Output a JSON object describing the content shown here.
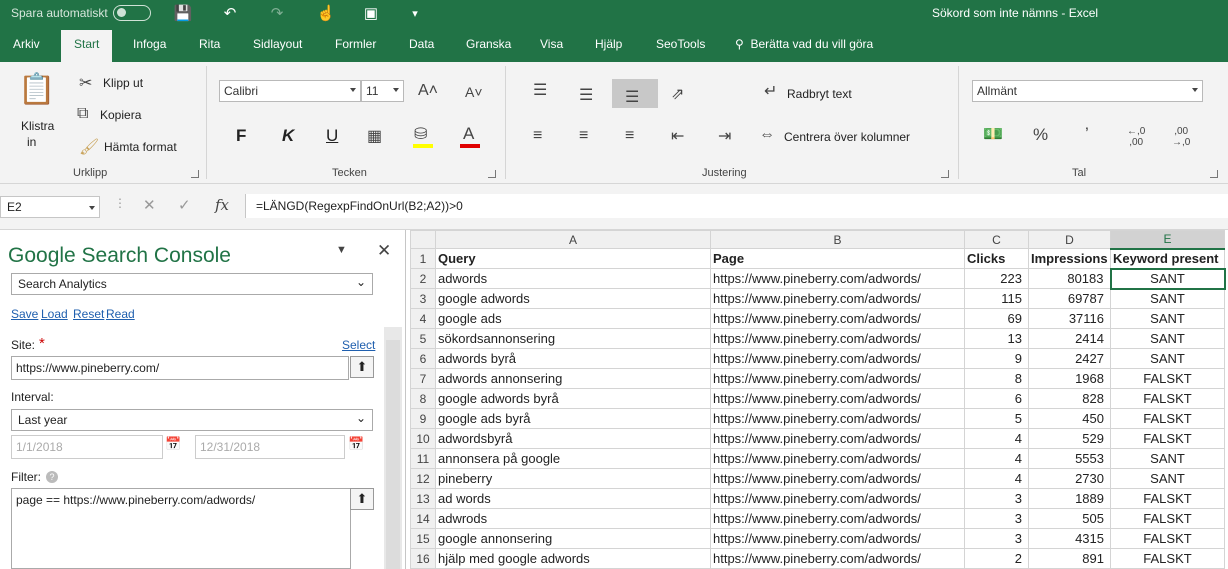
{
  "titlebar": {
    "autosave_label": "Spara automatiskt",
    "doc_title": "Sökord som inte nämns  -  Excel"
  },
  "tabs": [
    "Arkiv",
    "Start",
    "Infoga",
    "Rita",
    "Sidlayout",
    "Formler",
    "Data",
    "Granska",
    "Visa",
    "Hjälp",
    "SeoTools"
  ],
  "active_tab": "Start",
  "tellme": "Berätta vad du vill göra",
  "ribbon": {
    "clipboard": {
      "paste": "Klistra",
      "paste2": "in",
      "cut": "Klipp ut",
      "copy": "Kopiera",
      "format_painter": "Hämta format",
      "label": "Urklipp"
    },
    "font": {
      "name": "Calibri",
      "size": "11",
      "bold": "F",
      "italic": "K",
      "underline": "U",
      "label": "Tecken"
    },
    "alignment": {
      "wrap": "Radbryt text",
      "merge": "Centrera över kolumner",
      "label": "Justering"
    },
    "number": {
      "format": "Allmänt",
      "label": "Tal"
    }
  },
  "formula_bar": {
    "name_box": "E2",
    "formula": "=LÄNGD(RegexpFindOnUrl(B2;A2))>0"
  },
  "pane": {
    "title": "Google Search Console",
    "mode": "Search Analytics",
    "links": [
      "Save",
      "Load",
      "Reset",
      "Read"
    ],
    "site_label": "Site:",
    "select_link": "Select",
    "site_value": "https://www.pineberry.com/",
    "interval_label": "Interval:",
    "interval_value": "Last year",
    "date_from": "1/1/2018",
    "date_to": "12/31/2018",
    "filter_label": "Filter:",
    "filter_value": "page == https://www.pineberry.com/adwords/"
  },
  "sheet": {
    "columns": [
      "A",
      "B",
      "C",
      "D",
      "E"
    ],
    "header": [
      "Query",
      "Page",
      "Clicks",
      "Impressions",
      "Keyword present"
    ],
    "rows": [
      [
        "adwords",
        "https://www.pineberry.com/adwords/",
        "223",
        "80183",
        "SANT"
      ],
      [
        "google adwords",
        "https://www.pineberry.com/adwords/",
        "115",
        "69787",
        "SANT"
      ],
      [
        "google ads",
        "https://www.pineberry.com/adwords/",
        "69",
        "37116",
        "SANT"
      ],
      [
        "sökordsannonsering",
        "https://www.pineberry.com/adwords/",
        "13",
        "2414",
        "SANT"
      ],
      [
        "adwords byrå",
        "https://www.pineberry.com/adwords/",
        "9",
        "2427",
        "SANT"
      ],
      [
        "adwords annonsering",
        "https://www.pineberry.com/adwords/",
        "8",
        "1968",
        "FALSKT"
      ],
      [
        "google adwords byrå",
        "https://www.pineberry.com/adwords/",
        "6",
        "828",
        "FALSKT"
      ],
      [
        "google ads byrå",
        "https://www.pineberry.com/adwords/",
        "5",
        "450",
        "FALSKT"
      ],
      [
        "adwordsbyrå",
        "https://www.pineberry.com/adwords/",
        "4",
        "529",
        "FALSKT"
      ],
      [
        "annonsera på google",
        "https://www.pineberry.com/adwords/",
        "4",
        "5553",
        "SANT"
      ],
      [
        "pineberry",
        "https://www.pineberry.com/adwords/",
        "4",
        "2730",
        "SANT"
      ],
      [
        "ad words",
        "https://www.pineberry.com/adwords/",
        "3",
        "1889",
        "FALSKT"
      ],
      [
        "adwrods",
        "https://www.pineberry.com/adwords/",
        "3",
        "505",
        "FALSKT"
      ],
      [
        "google annonsering",
        "https://www.pineberry.com/adwords/",
        "3",
        "4315",
        "FALSKT"
      ],
      [
        "hjälp med google adwords",
        "https://www.pineberry.com/adwords/",
        "2",
        "891",
        "FALSKT"
      ]
    ]
  }
}
